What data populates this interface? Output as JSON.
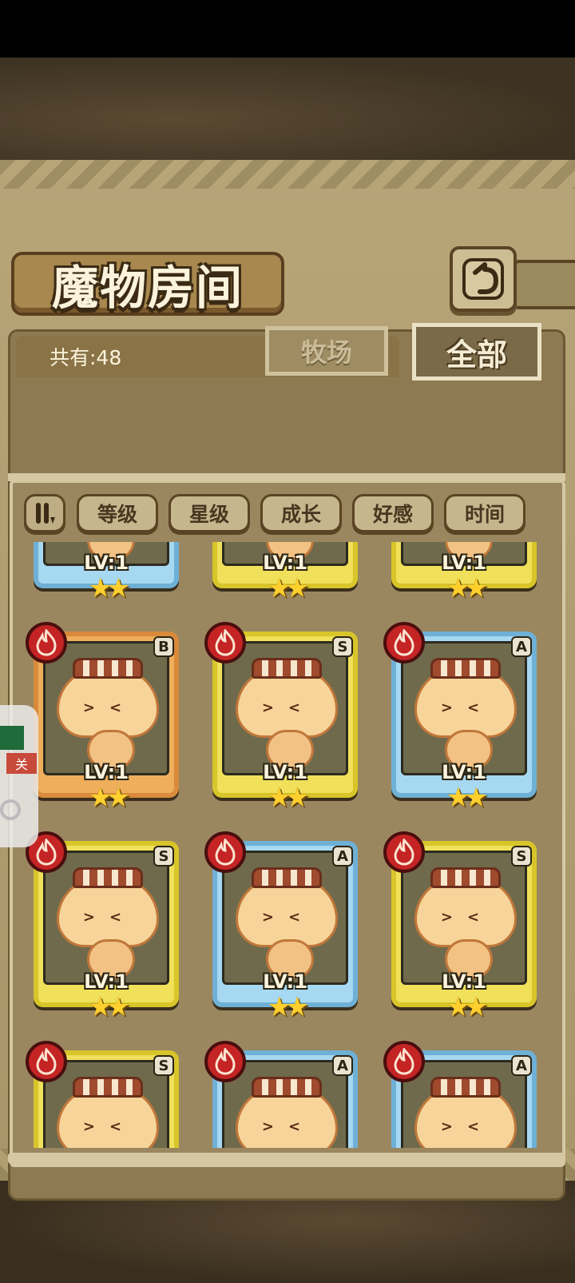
{
  "screen": {
    "title": "魔物房间",
    "count_label": "共有:48",
    "tabs": [
      {
        "label": "牧场",
        "active": false
      },
      {
        "label": "全部",
        "active": true
      }
    ],
    "sort_buttons": [
      "等级",
      "星级",
      "成长",
      "好感",
      "时间"
    ],
    "floating_widget": {
      "close_label": "关"
    }
  },
  "cards": [
    {
      "rank": "",
      "level": "LV:1",
      "stars": 2,
      "frame": "a",
      "partial_top": true
    },
    {
      "rank": "",
      "level": "LV:1",
      "stars": 2,
      "frame": "s",
      "partial_top": true
    },
    {
      "rank": "",
      "level": "LV:1",
      "stars": 2,
      "frame": "s",
      "partial_top": true
    },
    {
      "rank": "B",
      "level": "LV:1",
      "stars": 2,
      "frame": "b"
    },
    {
      "rank": "S",
      "level": "LV:1",
      "stars": 2,
      "frame": "s"
    },
    {
      "rank": "A",
      "level": "LV:1",
      "stars": 2,
      "frame": "a"
    },
    {
      "rank": "S",
      "level": "LV:1",
      "stars": 2,
      "frame": "s"
    },
    {
      "rank": "A",
      "level": "LV:1",
      "stars": 2,
      "frame": "a"
    },
    {
      "rank": "S",
      "level": "LV:1",
      "stars": 2,
      "frame": "s"
    },
    {
      "rank": "S",
      "level": "",
      "stars": 0,
      "frame": "s",
      "partial_bottom": true
    },
    {
      "rank": "A",
      "level": "",
      "stars": 0,
      "frame": "a",
      "partial_bottom": true
    },
    {
      "rank": "A",
      "level": "",
      "stars": 0,
      "frame": "a",
      "partial_bottom": true
    }
  ],
  "colors": {
    "element_fire": "#c42424",
    "rank_s": "#d8c52a",
    "rank_a": "#6fb0d6",
    "rank_b": "#d98a3a"
  },
  "icons": {
    "back": "return-arrow-icon",
    "sort_order": "sort-order-icon",
    "element": "fire-element-icon",
    "star": "star-icon"
  }
}
